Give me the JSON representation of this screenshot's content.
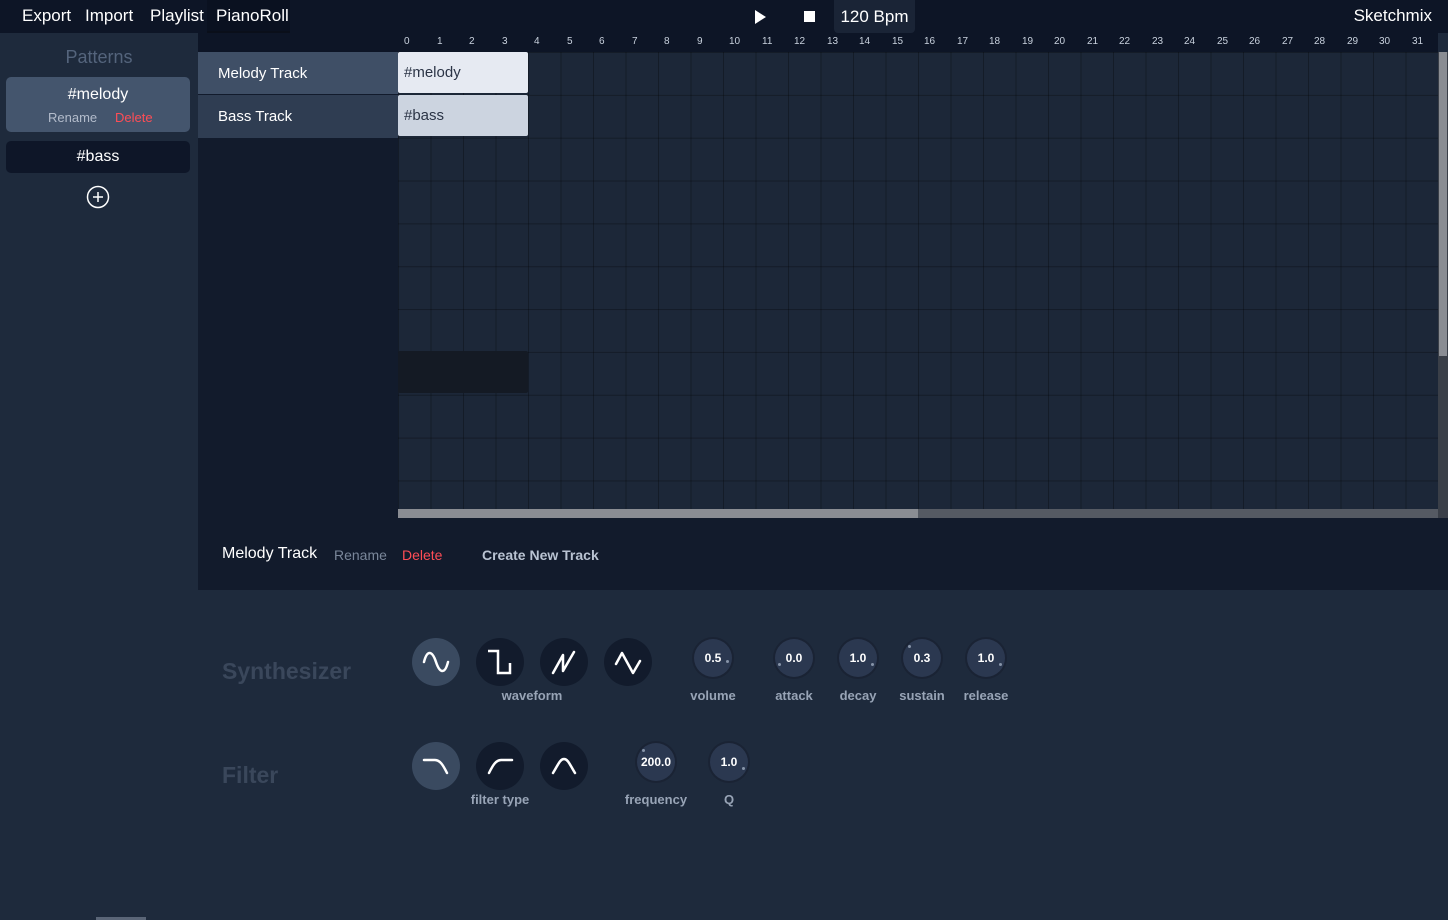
{
  "menu": {
    "items": [
      "Export",
      "Import",
      "Playlist",
      "PianoRoll"
    ],
    "brand": "Sketchmix"
  },
  "transport": {
    "bpm": "120 Bpm"
  },
  "sidebar": {
    "title": "Patterns",
    "patterns": [
      {
        "name": "#melody",
        "rename": "Rename",
        "delete": "Delete"
      },
      {
        "name": "#bass"
      }
    ]
  },
  "tracks": [
    {
      "name": "Melody Track",
      "clip": "#melody"
    },
    {
      "name": "Bass Track",
      "clip": "#bass"
    }
  ],
  "ruler": {
    "ticks": [
      "0",
      "1",
      "2",
      "3",
      "4",
      "5",
      "6",
      "7",
      "8",
      "9",
      "10",
      "11",
      "12",
      "13",
      "14",
      "15",
      "16",
      "17",
      "18",
      "19",
      "20",
      "21",
      "22",
      "23",
      "24",
      "25",
      "26",
      "27",
      "28",
      "29",
      "30",
      "31"
    ]
  },
  "trackbar": {
    "name": "Melody Track",
    "rename": "Rename",
    "delete": "Delete",
    "create": "Create New Track"
  },
  "synth": {
    "title": "Synthesizer",
    "waveform_label": "waveform",
    "knobs": [
      {
        "label": "volume",
        "value": "0.5"
      },
      {
        "label": "attack",
        "value": "0.0"
      },
      {
        "label": "decay",
        "value": "1.0"
      },
      {
        "label": "sustain",
        "value": "0.3"
      },
      {
        "label": "release",
        "value": "1.0"
      }
    ]
  },
  "filter": {
    "title": "Filter",
    "type_label": "filter type",
    "knobs": [
      {
        "label": "frequency",
        "value": "200.0"
      },
      {
        "label": "Q",
        "value": "1.0"
      }
    ]
  },
  "icons": [
    "play-icon",
    "stop-icon",
    "plus-circle-icon",
    "sine-wave-icon",
    "square-wave-icon",
    "sawtooth-wave-icon",
    "triangle-wave-icon",
    "lowpass-icon",
    "highpass-icon",
    "bandpass-icon"
  ]
}
